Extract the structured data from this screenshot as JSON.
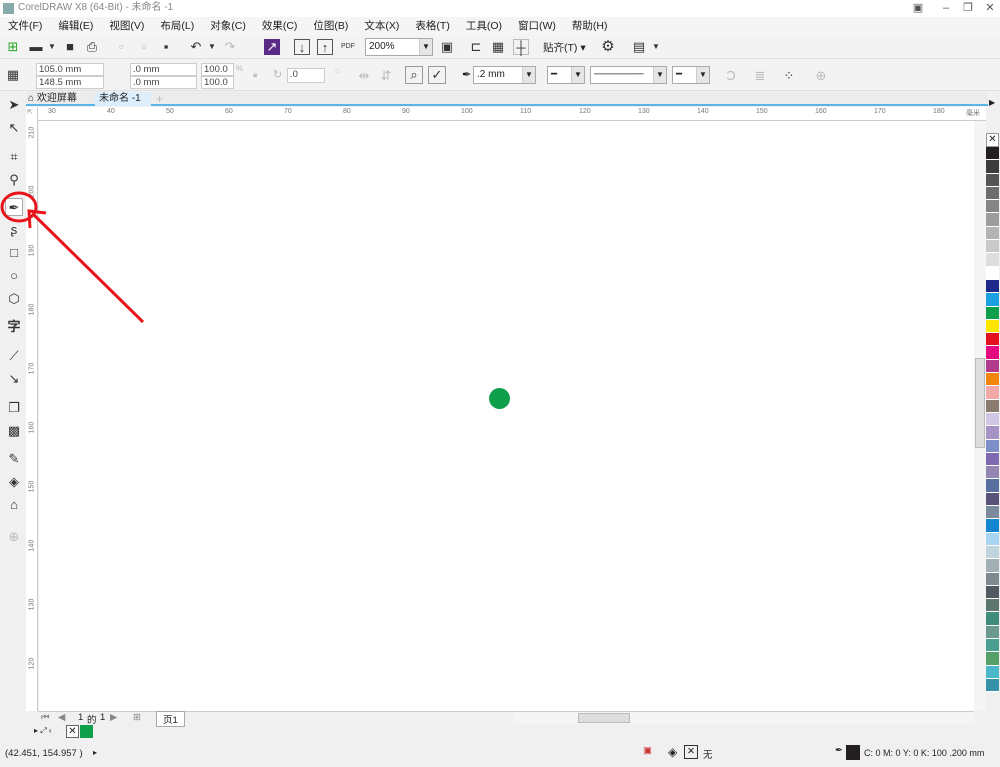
{
  "window": {
    "title": "CorelDRAW X8 (64-Bit) - 未命名 -1"
  },
  "menu": [
    "文件(F)",
    "编辑(E)",
    "视图(V)",
    "布局(L)",
    "对象(C)",
    "效果(C)",
    "位图(B)",
    "文本(X)",
    "表格(T)",
    "工具(O)",
    "窗口(W)",
    "帮助(H)"
  ],
  "toolbar": {
    "zoom": "200%",
    "snap": "贴齐(T)",
    "pdf": "PDF"
  },
  "property_bar": {
    "x": "105.0 mm",
    "y": "148.5 mm",
    "w": ".0 mm",
    "h": ".0 mm",
    "scale_w": "100.0",
    "scale_h": "100.0",
    "percent": "%",
    "rotation": ".0",
    "outline_width": ".2 mm"
  },
  "tabs": [
    {
      "label": "欢迎屏幕"
    },
    {
      "label": "未命名 -1",
      "active": true
    }
  ],
  "ruler": {
    "h_labels": [
      "30",
      "40",
      "50",
      "60",
      "70",
      "80",
      "90",
      "100",
      "110",
      "120",
      "130",
      "140",
      "150",
      "160",
      "170",
      "180"
    ],
    "v_labels": [
      "210",
      "200",
      "190",
      "180",
      "170",
      "160",
      "150",
      "140",
      "130",
      "120"
    ],
    "unit": "毫米"
  },
  "canvas": {
    "dot_color": "#0e9f4a"
  },
  "page_nav": {
    "current": "1",
    "of": "的",
    "total": "1",
    "page_tab": "页1"
  },
  "palette": [
    "#231f20",
    "#3d3b3b",
    "#555",
    "#6d6d6d",
    "#858585",
    "#9d9d9d",
    "#b3b3b3",
    "#c9c9c9",
    "#dedede",
    "#ffffff",
    "#1e2a8a",
    "#1da0e2",
    "#0e9f4a",
    "#ffe600",
    "#e3101e",
    "#e4097e",
    "#b33b8b",
    "#f0870c",
    "#f2a8a8",
    "#8b7a6f",
    "#cfc7e4",
    "#a493c4",
    "#7c8fc8",
    "#7d6ab0",
    "#9585b3",
    "#586fa0",
    "#5a5379",
    "#7c8a9e",
    "#1486d0",
    "#a8d6f2",
    "#bfd4dc",
    "#a2afb5",
    "#7f8a90",
    "#505a60",
    "#5e7670",
    "#3f8c7a",
    "#6b9990",
    "#4aa090",
    "#54a068",
    "#4ab8c8",
    "#3592a8"
  ],
  "doc_palette": {
    "colors": [
      "#0e9f4a"
    ]
  },
  "status": {
    "coords": "(42.451, 154.957 )",
    "fill_label": "无",
    "outline_text": "C: 0 M: 0 Y: 0 K: 100  .200 mm",
    "outline_color": "#231f20"
  },
  "annotation": {
    "color": "#e8141b"
  }
}
